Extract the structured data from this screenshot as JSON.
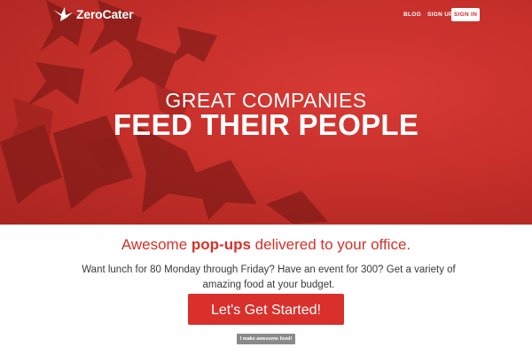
{
  "brand": {
    "name": "ZeroCater"
  },
  "nav": {
    "blog": "BLOG",
    "signup": "SIGN UP",
    "signin": "SIGN IN"
  },
  "hero": {
    "line1": "GREAT COMPANIES",
    "line2": "FEED THEIR PEOPLE"
  },
  "content": {
    "tagline_pre": "Awesome ",
    "tagline_bold": "pop-ups",
    "tagline_post": " delivered to your office.",
    "description": "Want lunch for 80 Monday through Friday? Have an event for 300? Get a variety of amazing food at your budget.",
    "cta_label": "Let's Get Started!",
    "caterer_label": "I make awesome food!"
  },
  "colors": {
    "hero_red": "#c8302b",
    "accent_red": "#d9302c",
    "button_gray": "#8a8a8a"
  }
}
